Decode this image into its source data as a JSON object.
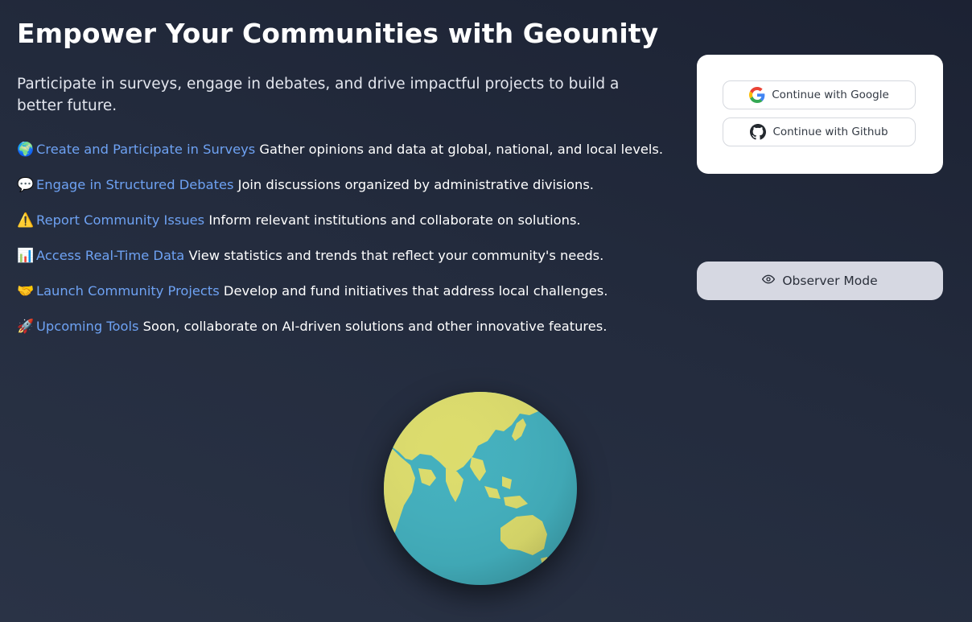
{
  "hero": {
    "title": "Empower Your Communities with Geounity",
    "subtitle": "Participate in surveys, engage in debates, and drive impactful projects to build a better future."
  },
  "features": [
    {
      "emoji": "🌍",
      "icon": "globe-icon",
      "link": "Create and Participate in Surveys",
      "text": " Gather opinions and data at global, national, and local levels."
    },
    {
      "emoji": "💬",
      "icon": "speech-bubble-icon",
      "link": "Engage in Structured Debates",
      "text": " Join discussions organized by administrative divisions."
    },
    {
      "emoji": "⚠️",
      "icon": "warning-icon",
      "link": "Report Community Issues",
      "text": " Inform relevant institutions and collaborate on solutions."
    },
    {
      "emoji": "📊",
      "icon": "bar-chart-icon",
      "link": "Access Real-Time Data",
      "text": " View statistics and trends that reflect your community's needs."
    },
    {
      "emoji": "🤝",
      "icon": "handshake-icon",
      "link": "Launch Community Projects",
      "text": " Develop and fund initiatives that address local challenges."
    },
    {
      "emoji": "🚀",
      "icon": "rocket-icon",
      "link": "Upcoming Tools",
      "text": " Soon, collaborate on AI-driven solutions and other innovative features."
    }
  ],
  "auth": {
    "google_label": "Continue with Google",
    "github_label": "Continue with Github"
  },
  "observer": {
    "label": "Observer Mode"
  },
  "colors": {
    "background_top": "#1c2233",
    "background_bottom": "#2a3346",
    "link": "#6ea2f3",
    "observer_button": "#d6d8e2",
    "globe_ocean": "#43b0be",
    "globe_land": "#dcdc6c"
  }
}
